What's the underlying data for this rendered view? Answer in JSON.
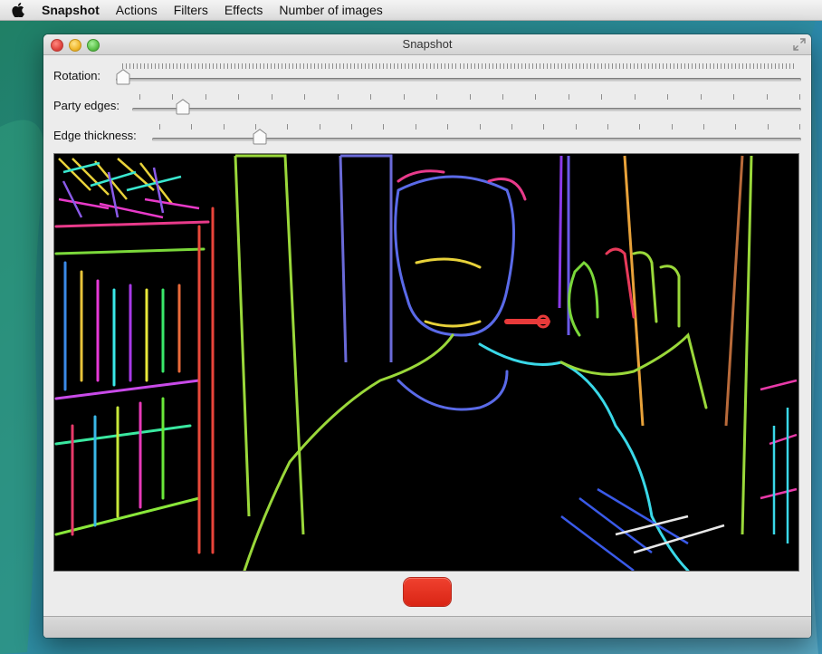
{
  "menubar": {
    "app_name": "Snapshot",
    "items": [
      "Actions",
      "Filters",
      "Effects",
      "Number of images"
    ],
    "apple_icon": "apple-logo-icon"
  },
  "window": {
    "title": "Snapshot"
  },
  "sliders": [
    {
      "label": "Rotation:",
      "value_fraction": 0.0,
      "ticks": "dense"
    },
    {
      "label": "Party edges:",
      "value_fraction": 0.08,
      "ticks": 21
    },
    {
      "label": "Edge thickness:",
      "value_fraction": 0.17,
      "ticks": 21
    }
  ],
  "preview": {
    "description_icon": "edge-detected-camera-preview"
  },
  "snap_button": {
    "color": "#e8321f"
  }
}
